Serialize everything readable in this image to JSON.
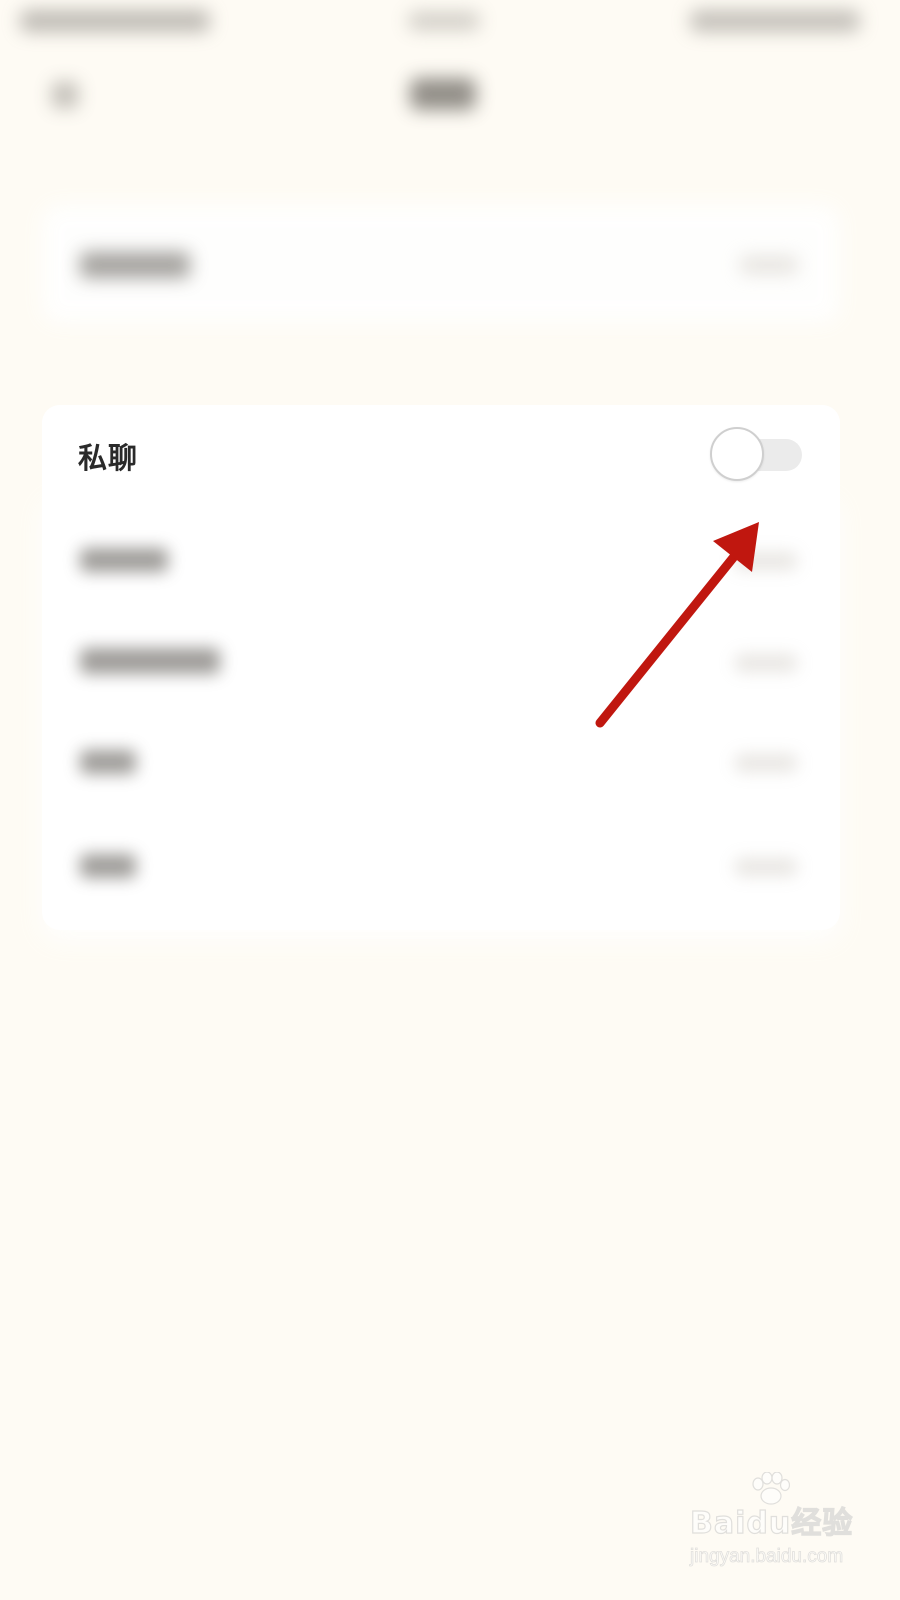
{
  "settings": {
    "private_chat": {
      "label": "私聊",
      "toggle_on": false
    }
  },
  "colors": {
    "page_background": "#fefbf4",
    "card_background": "#ffffff",
    "toggle_track_off": "#ebebeb",
    "toggle_knob_border": "#cfcfcf",
    "annotation_arrow": "#c0170f"
  },
  "annotation": {
    "type": "arrow",
    "target": "private-chat-toggle"
  },
  "watermark": {
    "brand": "Baidu经验",
    "url": "jingyan.baidu.com"
  }
}
